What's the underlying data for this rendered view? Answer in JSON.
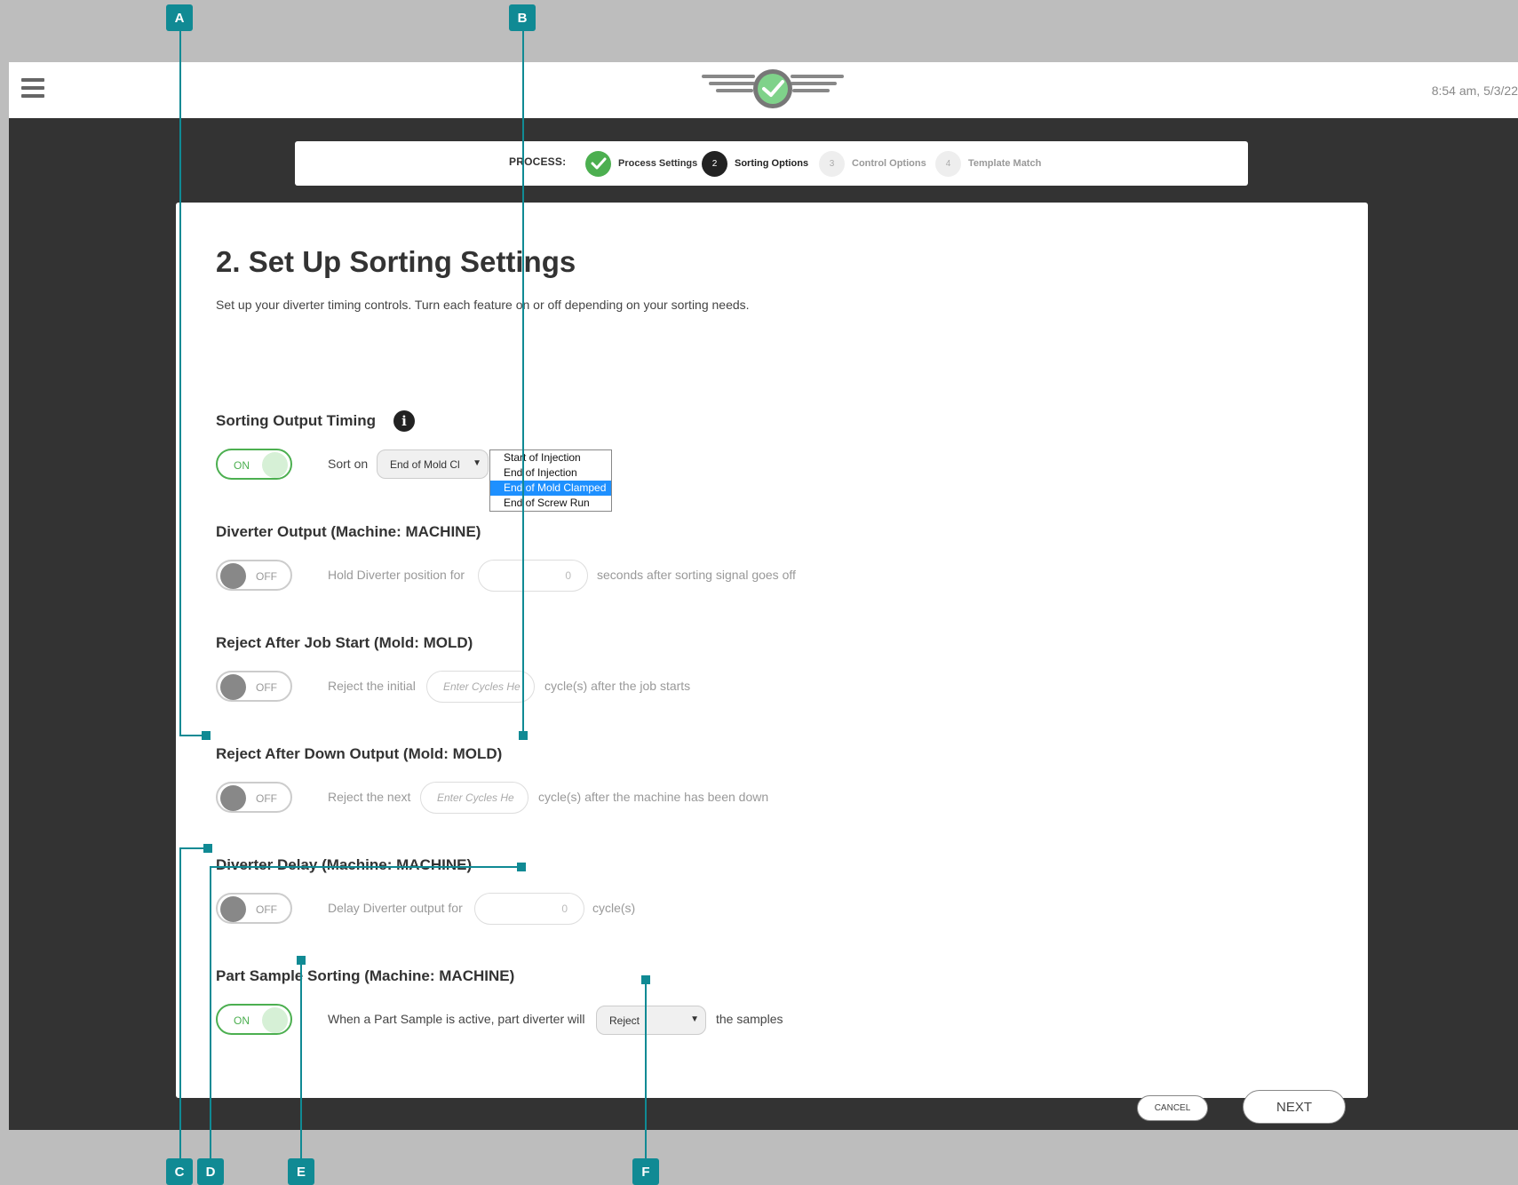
{
  "header": {
    "clock": "8:54 am, 5/3/22"
  },
  "stepper": {
    "prefix": "PROCESS:",
    "steps": [
      {
        "number": "",
        "label": "Process Settings",
        "state": "done"
      },
      {
        "number": "2",
        "label": "Sorting Options",
        "state": "active"
      },
      {
        "number": "3",
        "label": "Control Options",
        "state": "todo"
      },
      {
        "number": "4",
        "label": "Template Match",
        "state": "todo"
      }
    ]
  },
  "page": {
    "title": "2. Set Up Sorting Settings",
    "description": "Set up your diverter timing controls. Turn each feature on or off depending on your sorting needs."
  },
  "sections": {
    "sorting_output_timing": {
      "title": "Sorting Output Timing",
      "toggle": "ON",
      "label": "Sort on",
      "selected": "End of Mold Cl",
      "options": [
        "Start of Injection",
        "End of Injection",
        "End of Mold Clamped",
        "End of Screw Run"
      ],
      "selected_option_index": 2
    },
    "diverter_output": {
      "title": "Diverter Output (Machine: MACHINE)",
      "toggle": "OFF",
      "prefix": "Hold Diverter position for",
      "value": "0",
      "suffix": "seconds after sorting signal goes off"
    },
    "reject_after_job_start": {
      "title": "Reject After Job Start (Mold: MOLD)",
      "toggle": "OFF",
      "prefix": "Reject the initial",
      "placeholder": "Enter Cycles He",
      "suffix": "cycle(s) after the job starts"
    },
    "reject_after_down_output": {
      "title": "Reject After Down Output (Mold: MOLD)",
      "toggle": "OFF",
      "prefix": "Reject the next",
      "placeholder": "Enter Cycles He",
      "suffix": "cycle(s) after the machine has been down"
    },
    "diverter_delay": {
      "title": "Diverter Delay (Machine: MACHINE)",
      "toggle": "OFF",
      "prefix": "Delay Diverter output for",
      "value": "0",
      "suffix": "cycle(s)"
    },
    "part_sample_sorting": {
      "title": "Part Sample Sorting (Machine: MACHINE)",
      "toggle": "ON",
      "prefix": "When a Part Sample is active, part diverter will",
      "selected": "Reject",
      "suffix": "the samples"
    }
  },
  "actions": {
    "cancel": "CANCEL",
    "next": "NEXT"
  },
  "callouts": [
    "A",
    "B",
    "C",
    "D",
    "E",
    "F"
  ],
  "colors": {
    "accent": "#4caf50",
    "callout": "#108a94",
    "frame": "#333333",
    "selection": "#1e90ff"
  }
}
